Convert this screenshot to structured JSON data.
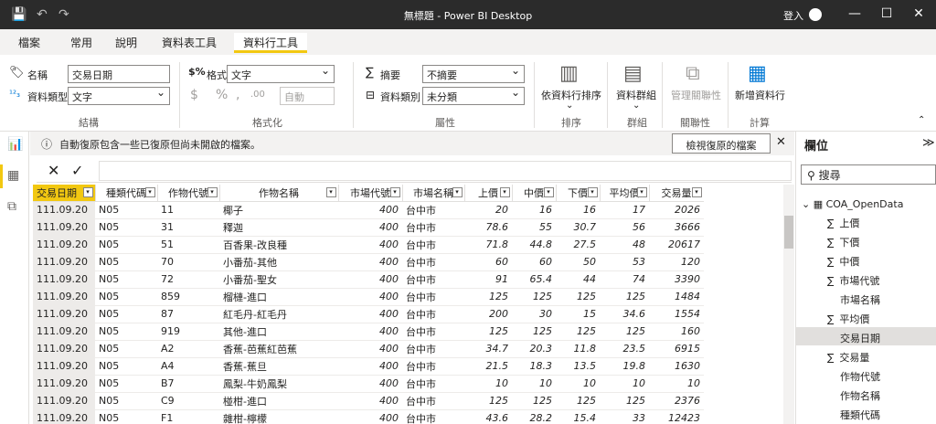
{
  "titlebar": {
    "title": "無標題 - Power BI Desktop",
    "signin": "登入",
    "save_icon": "💾",
    "undo_icon": "↶",
    "redo_icon": "↷",
    "minimize": "—",
    "maximize": "☐",
    "close": "✕"
  },
  "tabs": [
    "檔案",
    "常用",
    "說明",
    "資料表工具",
    "資料行工具"
  ],
  "ribbon": {
    "name_label": "名稱",
    "name_value": "交易日期",
    "type_label": "資料類型",
    "type_value": "文字",
    "group_structure": "結構",
    "format_label": "格式",
    "format_value": "文字",
    "currency": "$",
    "percent": "%",
    "comma": ",",
    "decimals": ".00",
    "auto_value": "自動",
    "group_format": "格式化",
    "summary_label": "摘要",
    "summary_value": "不摘要",
    "category_label": "資料類別",
    "category_value": "未分類",
    "group_props": "屬性",
    "sort_label": "依資料行排序",
    "group_sort": "排序",
    "groups_label": "資料群組",
    "group_groups": "群組",
    "relations_label": "管理關聯性",
    "group_rel": "關聯性",
    "newcol_label": "新增資料行",
    "group_calc": "計算"
  },
  "infobar": {
    "message": "自動復原包含一些已復原但尚未開啟的檔案。",
    "button": "檢視復原的檔案",
    "close": "✕",
    "info_icon": "ⓘ"
  },
  "formula": {
    "cancel": "✕",
    "commit": "✓"
  },
  "table": {
    "columns": [
      "交易日期",
      "種類代碼",
      "作物代號",
      "作物名稱",
      "市場代號",
      "市場名稱",
      "上價",
      "中價",
      "下價",
      "平均價",
      "交易量"
    ],
    "rows": [
      [
        "111.09.20",
        "N05",
        "11",
        "椰子",
        "400",
        "台中市",
        "20",
        "16",
        "16",
        "17",
        "2026"
      ],
      [
        "111.09.20",
        "N05",
        "31",
        "釋迦",
        "400",
        "台中市",
        "78.6",
        "55",
        "30.7",
        "56",
        "3666"
      ],
      [
        "111.09.20",
        "N05",
        "51",
        "百香果-改良種",
        "400",
        "台中市",
        "71.8",
        "44.8",
        "27.5",
        "48",
        "20617"
      ],
      [
        "111.09.20",
        "N05",
        "70",
        "小番茄-其他",
        "400",
        "台中市",
        "60",
        "60",
        "50",
        "53",
        "120"
      ],
      [
        "111.09.20",
        "N05",
        "72",
        "小番茄-聖女",
        "400",
        "台中市",
        "91",
        "65.4",
        "44",
        "74",
        "3390"
      ],
      [
        "111.09.20",
        "N05",
        "859",
        "榴槤-進口",
        "400",
        "台中市",
        "125",
        "125",
        "125",
        "125",
        "1484"
      ],
      [
        "111.09.20",
        "N05",
        "87",
        "紅毛丹-紅毛丹",
        "400",
        "台中市",
        "200",
        "30",
        "15",
        "34.6",
        "1554"
      ],
      [
        "111.09.20",
        "N05",
        "919",
        "其他-進口",
        "400",
        "台中市",
        "125",
        "125",
        "125",
        "125",
        "160"
      ],
      [
        "111.09.20",
        "N05",
        "A2",
        "香蕉-芭蕉紅芭蕉",
        "400",
        "台中市",
        "34.7",
        "20.3",
        "11.8",
        "23.5",
        "6915"
      ],
      [
        "111.09.20",
        "N05",
        "A4",
        "香蕉-蕉旦",
        "400",
        "台中市",
        "21.5",
        "18.3",
        "13.5",
        "19.8",
        "1630"
      ],
      [
        "111.09.20",
        "N05",
        "B7",
        "鳳梨-牛奶鳳梨",
        "400",
        "台中市",
        "10",
        "10",
        "10",
        "10",
        "10"
      ],
      [
        "111.09.20",
        "N05",
        "C9",
        "椪柑-進口",
        "400",
        "台中市",
        "125",
        "125",
        "125",
        "125",
        "2376"
      ],
      [
        "111.09.20",
        "N05",
        "F1",
        "雜柑-檸檬",
        "400",
        "台中市",
        "43.6",
        "28.2",
        "15.4",
        "33",
        "12423"
      ]
    ]
  },
  "fields": {
    "header": "欄位",
    "collapse": "≫",
    "search_placeholder": "搜尋",
    "table_name": "COA_OpenData",
    "items": [
      {
        "label": "上價",
        "sigma": "∑"
      },
      {
        "label": "下價",
        "sigma": "∑"
      },
      {
        "label": "中價",
        "sigma": "∑"
      },
      {
        "label": "市場代號",
        "sigma": "∑"
      },
      {
        "label": "市場名稱",
        "sigma": ""
      },
      {
        "label": "平均價",
        "sigma": "∑"
      },
      {
        "label": "交易日期",
        "sigma": ""
      },
      {
        "label": "交易量",
        "sigma": "∑"
      },
      {
        "label": "作物代號",
        "sigma": ""
      },
      {
        "label": "作物名稱",
        "sigma": ""
      },
      {
        "label": "種類代碼",
        "sigma": ""
      }
    ]
  }
}
